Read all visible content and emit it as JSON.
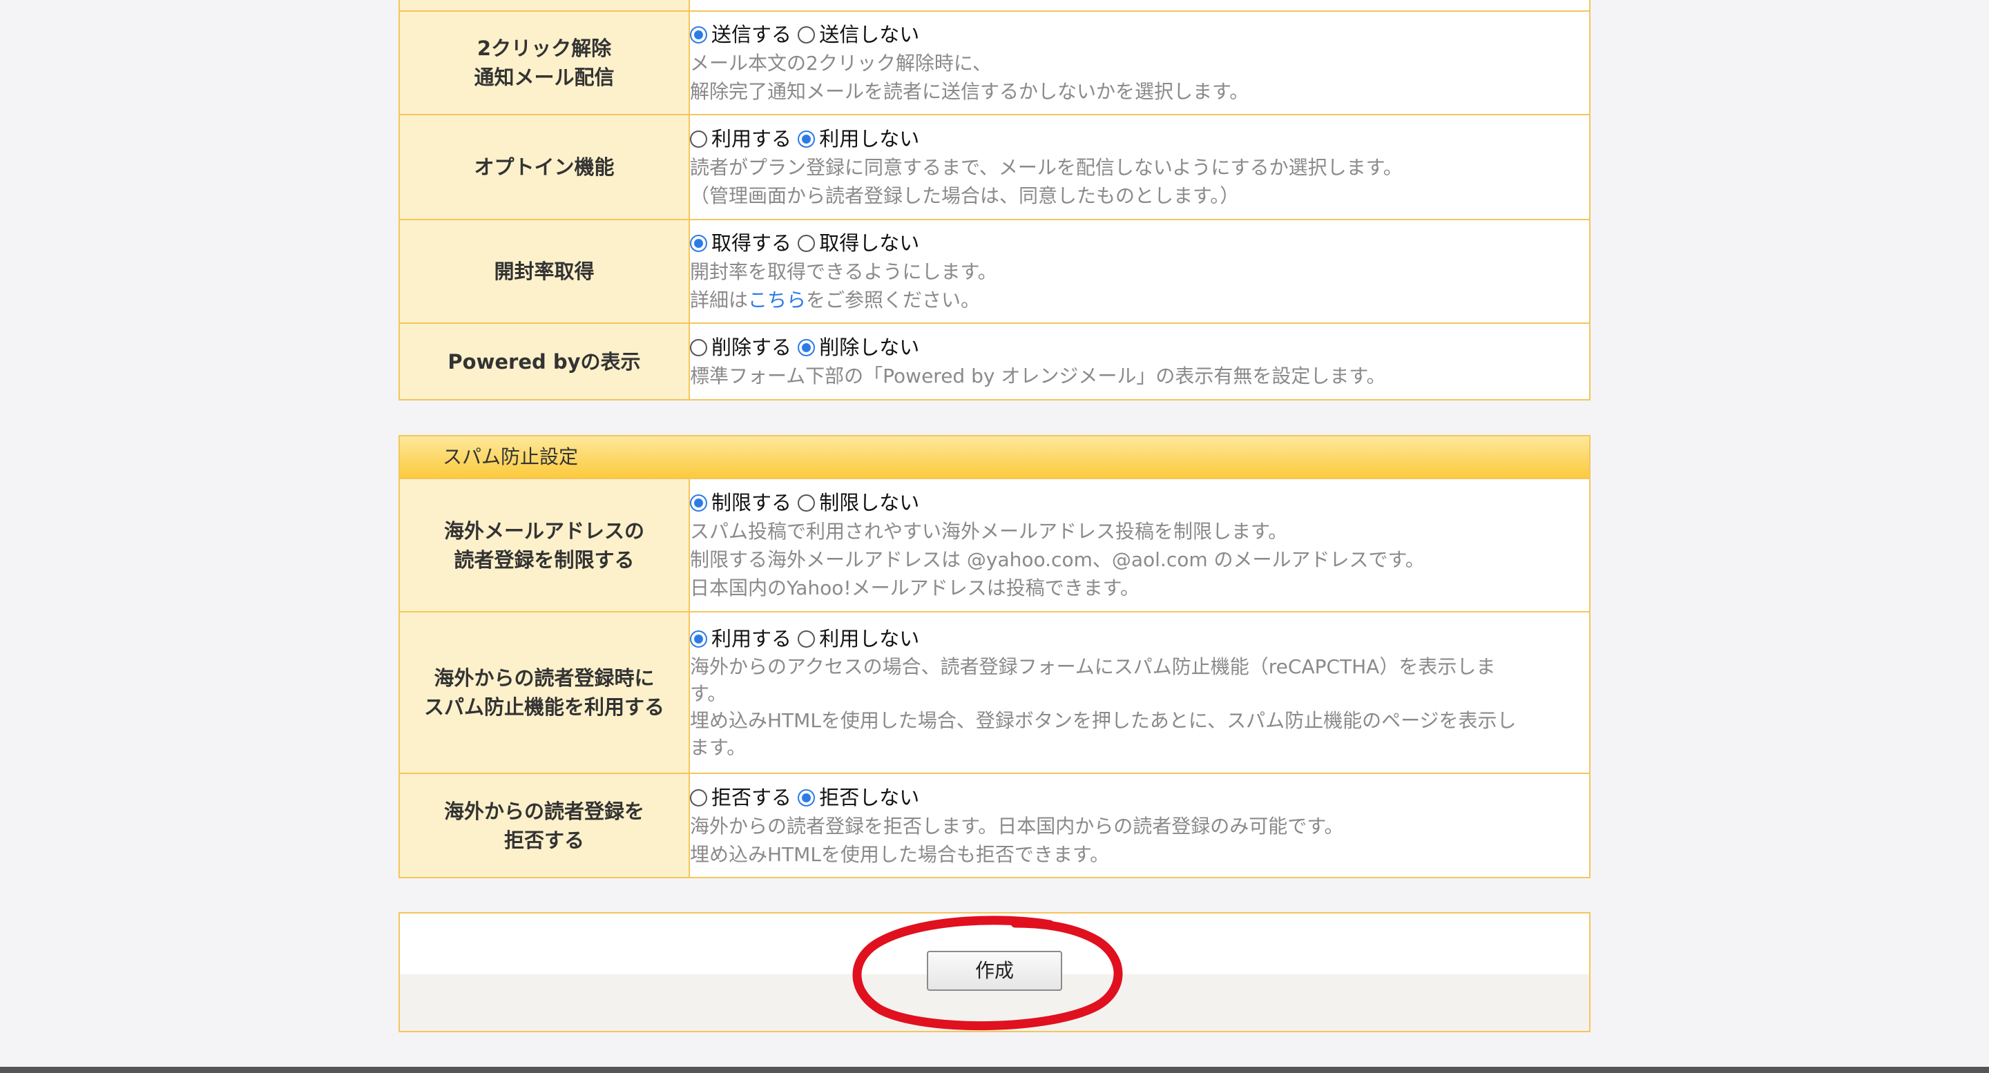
{
  "basic_settings": {
    "rows": [
      {
        "label": "2クリック解除\n通知メール配信",
        "options": [
          {
            "label": "送信する",
            "selected": true
          },
          {
            "label": "送信しない",
            "selected": false
          }
        ],
        "desc": [
          "メール本文の2クリック解除時に、",
          "解除完了通知メールを読者に送信するかしないかを選択します。"
        ]
      },
      {
        "label": "オプトイン機能",
        "options": [
          {
            "label": "利用する",
            "selected": false
          },
          {
            "label": "利用しない",
            "selected": true
          }
        ],
        "desc": [
          "読者がプラン登録に同意するまで、メールを配信しないようにするか選択します。",
          "（管理画面から読者登録した場合は、同意したものとします。）"
        ]
      },
      {
        "label": "開封率取得",
        "options": [
          {
            "label": "取得する",
            "selected": true
          },
          {
            "label": "取得しない",
            "selected": false
          }
        ],
        "desc_line1": "開封率を取得できるようにします。",
        "desc_line2_prefix": "詳細は",
        "desc_link": "こちら",
        "desc_line2_suffix": "をご参照ください。"
      },
      {
        "label": "Powered byの表示",
        "options": [
          {
            "label": "削除する",
            "selected": false
          },
          {
            "label": "削除しない",
            "selected": true
          }
        ],
        "desc": [
          "標準フォーム下部の「Powered by オレンジメール」の表示有無を設定します。"
        ]
      }
    ]
  },
  "spam_section": {
    "title": "スパム防止設定",
    "rows": [
      {
        "label": "海外メールアドレスの\n読者登録を制限する",
        "options": [
          {
            "label": "制限する",
            "selected": true
          },
          {
            "label": "制限しない",
            "selected": false
          }
        ],
        "desc": [
          "スパム投稿で利用されやすい海外メールアドレス投稿を制限します。",
          "制限する海外メールアドレスは @yahoo.com、@aol.com のメールアドレスです。",
          "日本国内のYahoo!メールアドレスは投稿できます。"
        ]
      },
      {
        "label": "海外からの読者登録時に\nスパム防止機能を利用する",
        "options": [
          {
            "label": "利用する",
            "selected": true
          },
          {
            "label": "利用しない",
            "selected": false
          }
        ],
        "desc": [
          "海外からのアクセスの場合、読者登録フォームにスパム防止機能（reCAPCTHA）を表示しま",
          "す。",
          "埋め込みHTMLを使用した場合、登録ボタンを押したあとに、スパム防止機能のページを表示し",
          "ます。"
        ]
      },
      {
        "label": "海外からの読者登録を\n拒否する",
        "options": [
          {
            "label": "拒否する",
            "selected": false
          },
          {
            "label": "拒否しない",
            "selected": true
          }
        ],
        "desc": [
          "海外からの読者登録を拒否します。日本国内からの読者登録のみ可能です。",
          "埋め込みHTMLを使用した場合も拒否できます。"
        ]
      }
    ]
  },
  "submit_label": "作成",
  "colors": {
    "accent": "#2c7be5",
    "border": "#f5c55c",
    "label_bg": "#fdf1cc",
    "annotation": "#e0101f"
  }
}
